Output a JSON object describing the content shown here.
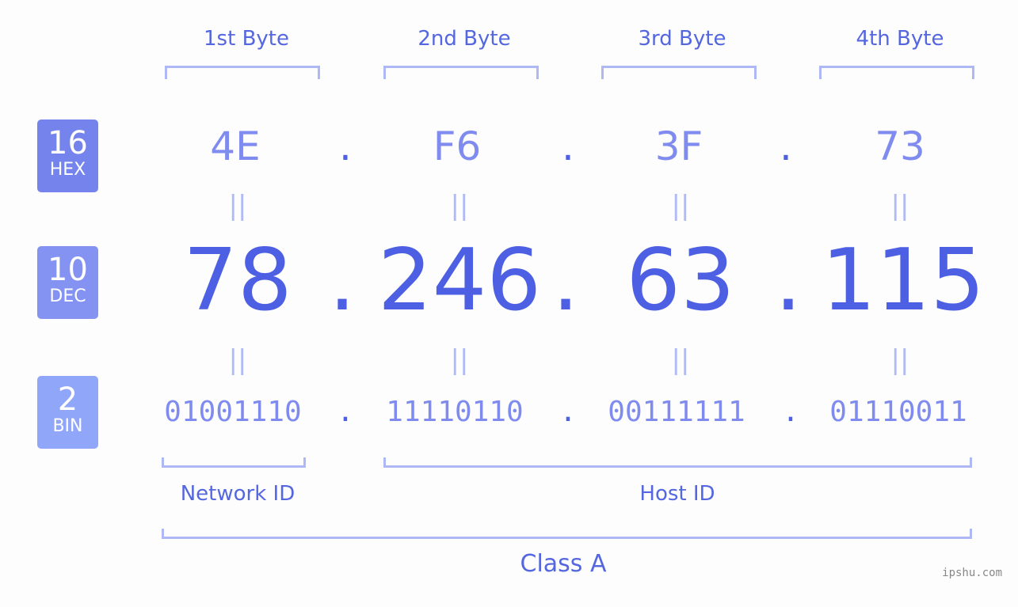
{
  "bytes": [
    {
      "label": "1st Byte",
      "hex": "4E",
      "dec": "78",
      "bin": "01001110"
    },
    {
      "label": "2nd Byte",
      "hex": "F6",
      "dec": "246",
      "bin": "11110110"
    },
    {
      "label": "3rd Byte",
      "hex": "3F",
      "dec": "63",
      "bin": "00111111"
    },
    {
      "label": "4th Byte",
      "hex": "73",
      "dec": "115",
      "bin": "01110011"
    }
  ],
  "badges": {
    "hex": {
      "num": "16",
      "label": "HEX",
      "color": "#7584ec"
    },
    "dec": {
      "num": "10",
      "label": "DEC",
      "color": "#8493f1"
    },
    "bin": {
      "num": "2",
      "label": "BIN",
      "color": "#90a6f9"
    }
  },
  "separator": ".",
  "equals": "||",
  "network_id_label": "Network ID",
  "host_id_label": "Host ID",
  "class_label": "Class A",
  "watermark": "ipshu.com"
}
